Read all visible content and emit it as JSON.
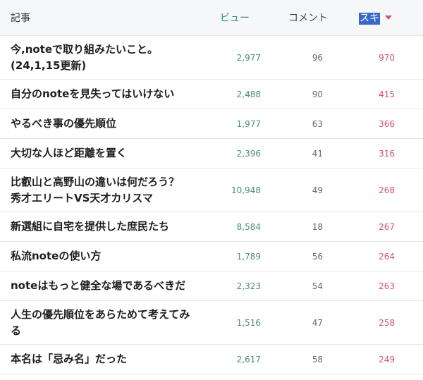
{
  "header": {
    "article": "記事",
    "views": "ビュー",
    "comments": "コメント",
    "likes": "スキ",
    "sort_icon": "caret-down-icon",
    "colors": {
      "views": "#3f8f74",
      "likes": "#d9576a",
      "selection": "#3a68c8"
    }
  },
  "rows": [
    {
      "title": "今,noteで取り組みたいこと。\n(24,1,15更新)",
      "views": "2,977",
      "comments": "96",
      "likes": "970"
    },
    {
      "title": "自分のnoteを見失ってはいけない",
      "views": "2,488",
      "comments": "90",
      "likes": "415"
    },
    {
      "title": "やるべき事の優先順位",
      "views": "1,977",
      "comments": "63",
      "likes": "366"
    },
    {
      "title": "大切な人ほど距離を置く",
      "views": "2,396",
      "comments": "41",
      "likes": "316"
    },
    {
      "title": "比叡山と高野山の違いは何だろう？\n秀才エリートVS天才カリスマ",
      "views": "10,948",
      "comments": "49",
      "likes": "268"
    },
    {
      "title": "新選組に自宅を提供した庶民たち",
      "views": "8,584",
      "comments": "18",
      "likes": "267"
    },
    {
      "title": "私流noteの使い方",
      "views": "1,789",
      "comments": "56",
      "likes": "264"
    },
    {
      "title": "noteはもっと健全な場であるべきだ",
      "views": "2,323",
      "comments": "54",
      "likes": "263"
    },
    {
      "title": "人生の優先順位をあらためて考えてみ\nる",
      "views": "1,516",
      "comments": "47",
      "likes": "258"
    },
    {
      "title": "本名は「忌み名」だった",
      "views": "2,617",
      "comments": "58",
      "likes": "249"
    }
  ]
}
